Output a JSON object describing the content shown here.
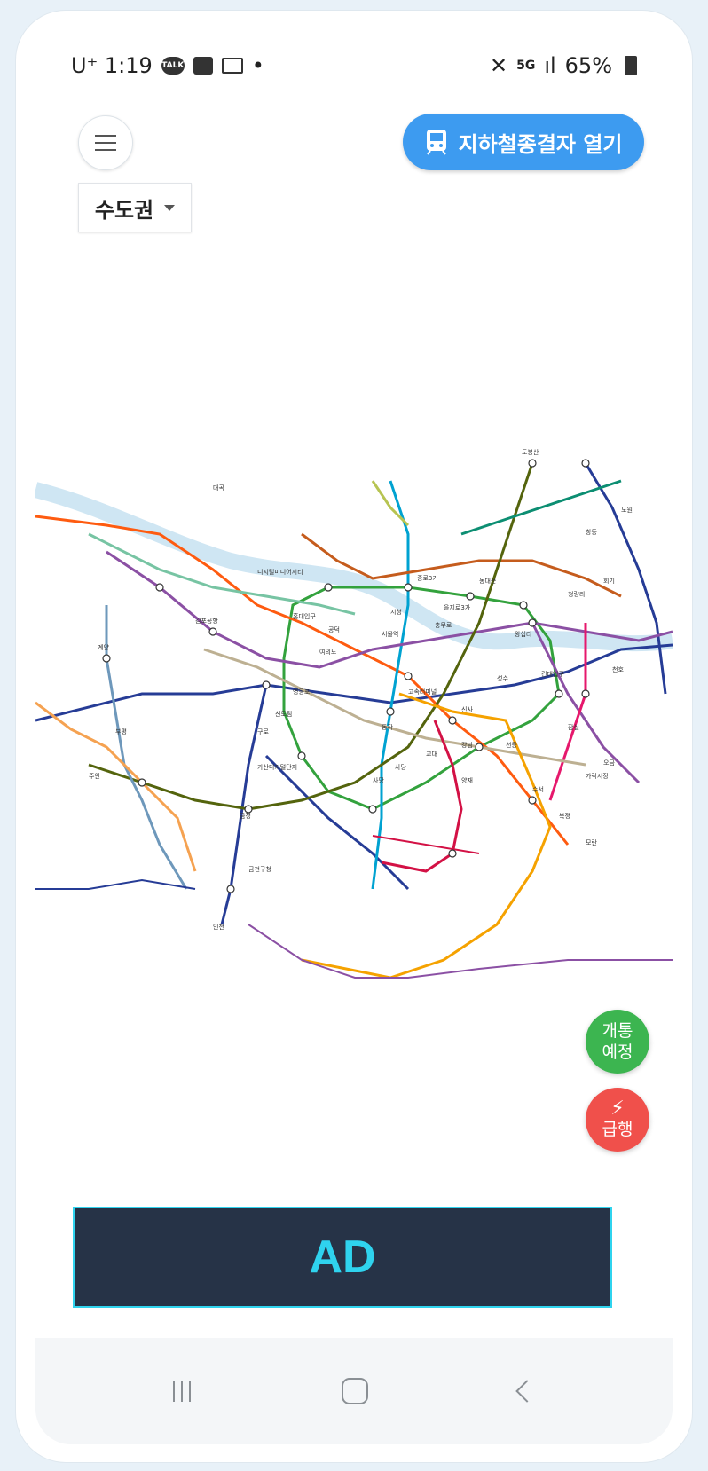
{
  "status_bar": {
    "carrier": "U⁺ 1:19",
    "battery": "65%",
    "icons": [
      "kakaotalk-icon",
      "photo-icon",
      "gmail-icon",
      "dot-icon",
      "mute-icon",
      "5g-icon",
      "signal-icon",
      "battery-icon"
    ]
  },
  "header": {
    "open_button_label": "지하철종결자 열기",
    "region_label": "수도권"
  },
  "map": {
    "station_labels": [
      "도봉산",
      "노원",
      "창동",
      "동대문",
      "종로3가",
      "을지로3가",
      "시청",
      "서울역",
      "충무로",
      "동작",
      "사당",
      "신사",
      "강남",
      "선릉",
      "교대",
      "잠실",
      "건대입구",
      "왕십리",
      "청량리",
      "회기",
      "성수",
      "천호",
      "고속터미널",
      "여의도",
      "영등포",
      "신도림",
      "구로",
      "가산디지털단지",
      "금정",
      "인천",
      "계양",
      "부평",
      "주안",
      "김포공항",
      "디지털미디어시티",
      "홍대입구",
      "공덕",
      "대곡",
      "수서",
      "복정",
      "모란",
      "오금",
      "가락시장",
      "금천구청",
      "사당",
      "양재"
    ]
  },
  "fabs": {
    "open_label": "개통\n예정",
    "express_label": "급행"
  },
  "ad": {
    "label": "AD"
  },
  "colors": {
    "open_button": "#3d9bf0",
    "fab_open": "#3cb550",
    "fab_express": "#f0504b",
    "ad_background": "#263347",
    "ad_accent": "#2fd3ee"
  }
}
